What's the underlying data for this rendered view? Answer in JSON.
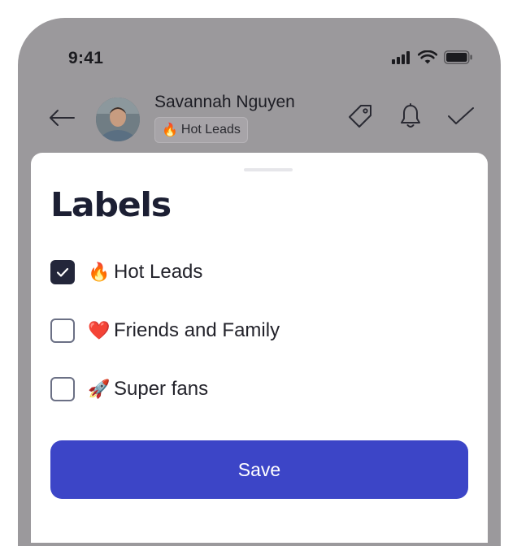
{
  "status_bar": {
    "time": "9:41",
    "icons": [
      "signal-icon",
      "wifi-icon",
      "battery-icon"
    ]
  },
  "header": {
    "back_icon": "arrow-left-icon",
    "contact_name": "Savannah Nguyen",
    "current_label": {
      "emoji": "🔥",
      "text": "Hot Leads"
    },
    "actions": [
      "tag-icon",
      "bell-icon",
      "check-icon"
    ]
  },
  "sheet": {
    "title": "Labels",
    "options": [
      {
        "emoji": "🔥",
        "label": "Hot Leads",
        "checked": true
      },
      {
        "emoji": "❤️",
        "label": "Friends and Family",
        "checked": false
      },
      {
        "emoji": "🚀",
        "label": "Super fans",
        "checked": false
      }
    ],
    "save_label": "Save"
  },
  "colors": {
    "overlay_background": "#9b999c",
    "primary_button": "#3c45c7",
    "checkbox_checked": "#23263a",
    "title_text": "#1c1f33"
  }
}
